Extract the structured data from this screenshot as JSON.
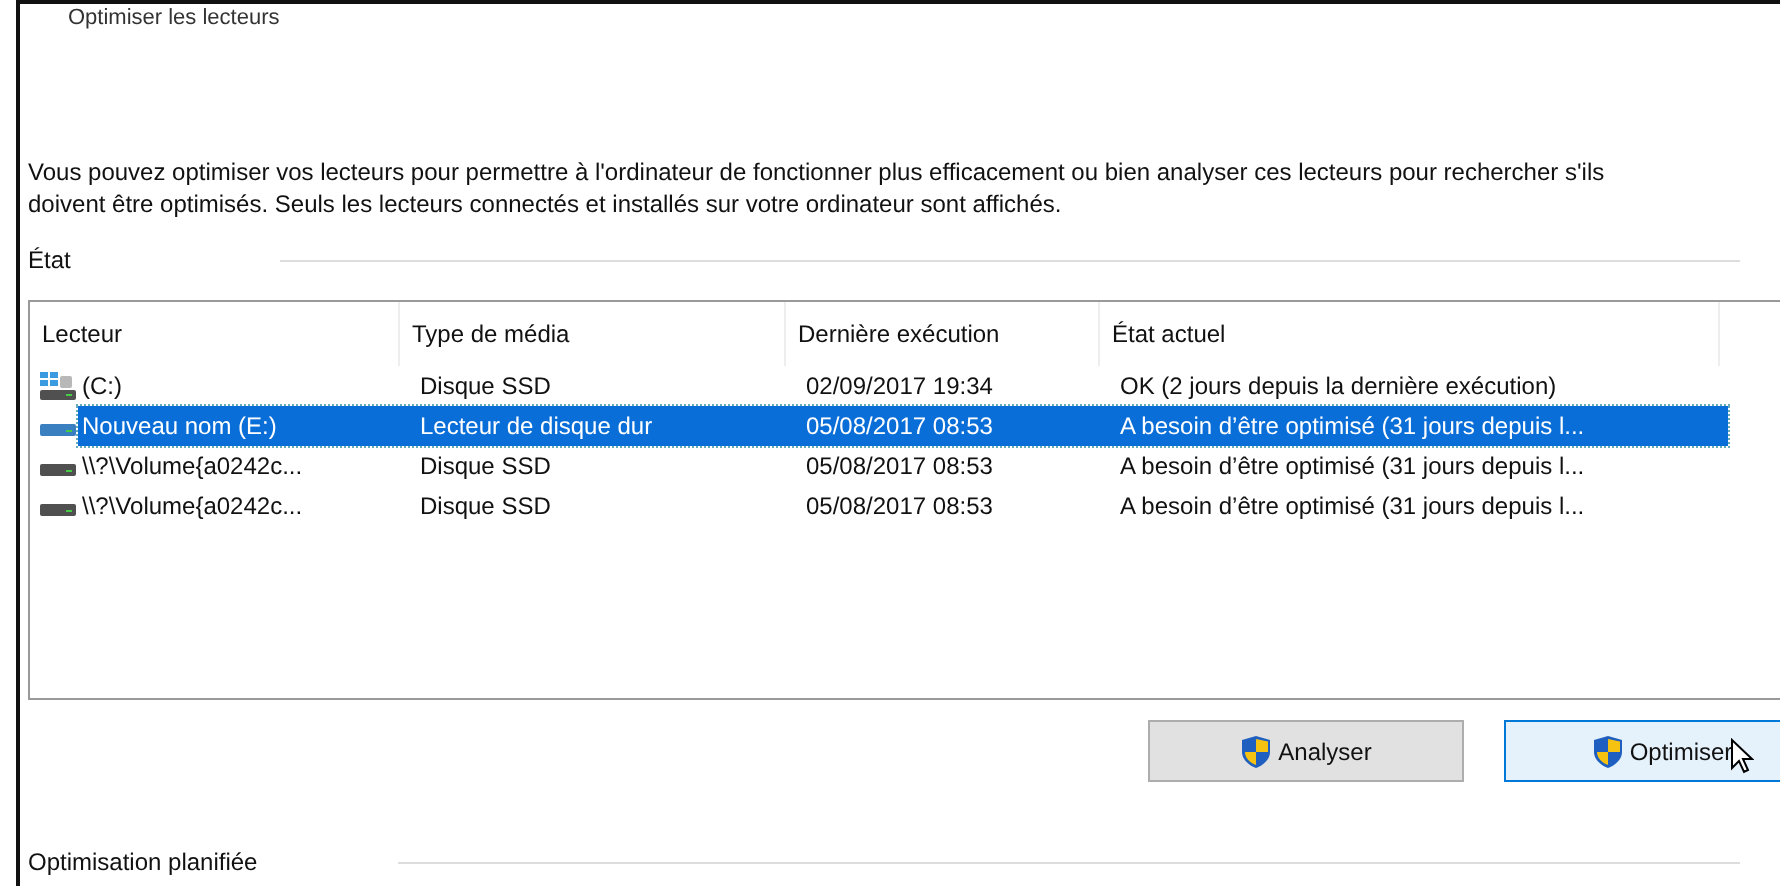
{
  "window": {
    "title": "Optimiser les lecteurs"
  },
  "description": "Vous pouvez optimiser vos lecteurs pour permettre à l'ordinateur de fonctionner plus efficacement ou bien analyser ces lecteurs pour rechercher s'ils doivent être optimisés. Seuls les lecteurs connectés et installés sur votre ordinateur sont affichés.",
  "status_group": {
    "label": "État"
  },
  "table": {
    "columns": [
      "Lecteur",
      "Type de média",
      "Dernière exécution",
      "État actuel"
    ],
    "rows": [
      {
        "kind": "system",
        "cells": [
          "(C:)",
          "Disque SSD",
          "02/09/2017 19:34",
          "OK (2 jours depuis la dernière exécution)"
        ],
        "selected": false
      },
      {
        "kind": "drive",
        "cells": [
          "Nouveau nom (E:)",
          "Lecteur de disque dur",
          "05/08/2017 08:53",
          "A besoin d’être optimisé (31 jours depuis l..."
        ],
        "selected": true
      },
      {
        "kind": "drive",
        "cells": [
          "\\\\?\\Volume{a0242c...",
          "Disque SSD",
          "05/08/2017 08:53",
          "A besoin d’être optimisé (31 jours depuis l..."
        ],
        "selected": false
      },
      {
        "kind": "drive",
        "cells": [
          "\\\\?\\Volume{a0242c...",
          "Disque SSD",
          "05/08/2017 08:53",
          "A besoin d’être optimisé (31 jours depuis l..."
        ],
        "selected": false
      }
    ]
  },
  "buttons": [
    {
      "label": "Analyser",
      "hovered": false
    },
    {
      "label": "Optimiser",
      "hovered": true
    }
  ],
  "schedule_group": {
    "label": "Optimisation planifiée"
  }
}
